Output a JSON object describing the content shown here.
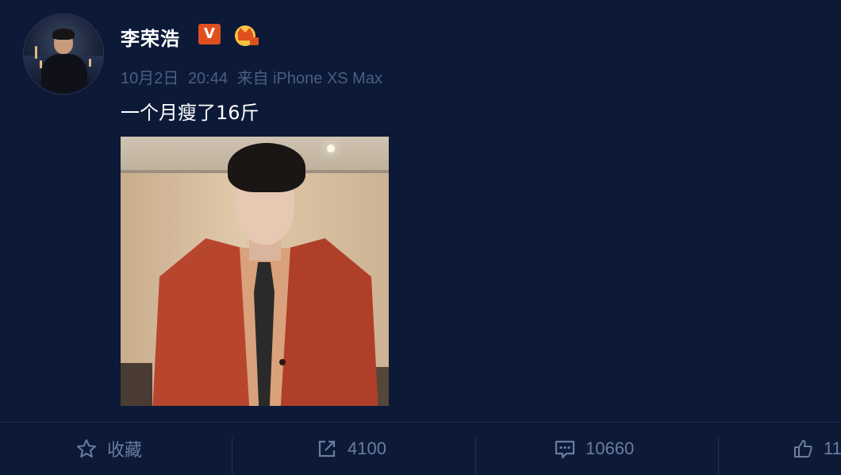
{
  "post": {
    "author": "李荣浩",
    "verified_badge": "V",
    "date": "10月2日",
    "time": "20:44",
    "source": "来自 iPhone XS Max",
    "text": "一个月瘦了16斤"
  },
  "actions": {
    "favorite_label": "收藏",
    "repost_count": "4100",
    "comment_count": "10660",
    "like_count": "11"
  },
  "colors": {
    "background": "#0c1a38",
    "badge_orange": "#e0501f",
    "meta_text": "#4b5d82",
    "action_text": "#6c7c9f"
  },
  "icons": [
    "star-icon",
    "repost-icon",
    "comment-icon",
    "thumbs-up-icon",
    "crown-icon"
  ]
}
